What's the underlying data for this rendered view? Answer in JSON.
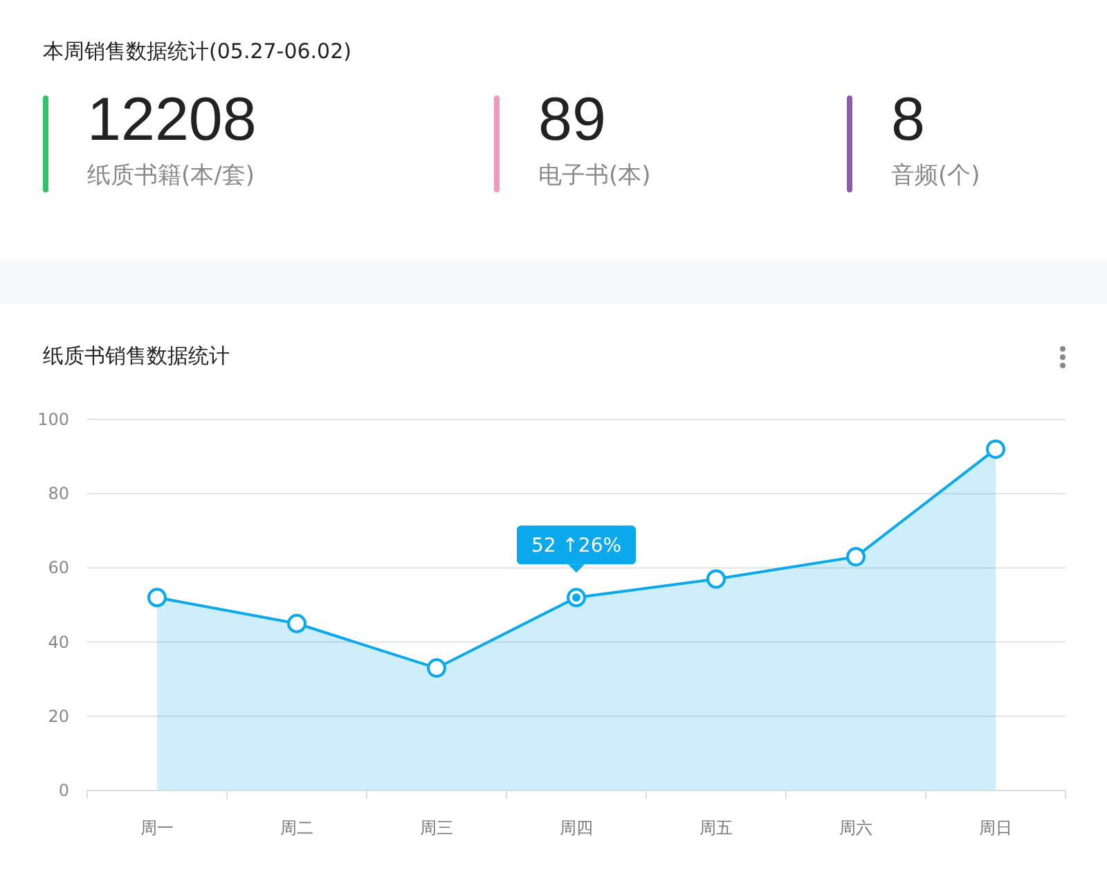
{
  "summary": {
    "title": "本周销售数据统计(05.27-06.02)",
    "stats": [
      {
        "value": "12208",
        "label": "纸质书籍(本/套)",
        "color": "#2dc26b"
      },
      {
        "value": "89",
        "label": "电子书(本)",
        "color": "#f098bd"
      },
      {
        "value": "8",
        "label": "音频(个)",
        "color": "#8a5dab"
      }
    ]
  },
  "chart_card": {
    "title": "纸质书销售数据统计",
    "chart_data": {
      "type": "area",
      "categories": [
        "周一",
        "周二",
        "周三",
        "周四",
        "周五",
        "周六",
        "周日"
      ],
      "series": [
        {
          "color": "#0ba9eb",
          "values": [
            52,
            45,
            33,
            52,
            57,
            63,
            92
          ]
        }
      ],
      "ylim": [
        0,
        100
      ],
      "grid": true,
      "yticks": [
        0,
        20,
        40,
        60,
        80,
        100
      ],
      "annotations": [
        {
          "x": "周四",
          "y": 52,
          "text": "52 ↑26%"
        }
      ]
    }
  }
}
